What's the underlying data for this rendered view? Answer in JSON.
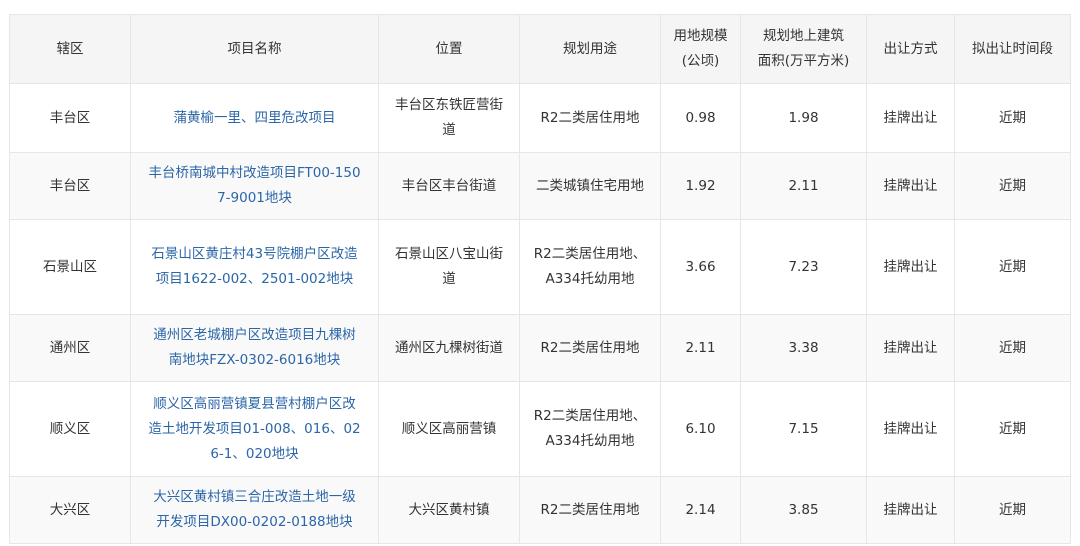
{
  "headers": [
    "辖区",
    "项目名称",
    "位置",
    "规划用途",
    "用地规模\n(公顷)",
    "规划地上建筑\n面积(万平方米)",
    "出让方式",
    "拟出让时间段"
  ],
  "rows": [
    {
      "district": "丰台区",
      "project": "蒲黄榆一里、四里危改项目",
      "location": "丰台区东铁匠营街道",
      "use": "R2二类居住用地",
      "area": "0.98",
      "building_area": "1.98",
      "method": "挂牌出让",
      "period": "近期"
    },
    {
      "district": "丰台区",
      "project": "丰台桥南城中村改造项目FT00-1507-9001地块",
      "location": "丰台区丰台街道",
      "use": "二类城镇住宅用地",
      "area": "1.92",
      "building_area": "2.11",
      "method": "挂牌出让",
      "period": "近期"
    },
    {
      "district": "石景山区",
      "project": "石景山区黄庄村43号院棚户区改造项目1622-002、2501-002地块",
      "location": "石景山区八宝山街道",
      "use": "R2二类居住用地、A334托幼用地",
      "area": "3.66",
      "building_area": "7.23",
      "method": "挂牌出让",
      "period": "近期"
    },
    {
      "district": "通州区",
      "project": "通州区老城棚户区改造项目九棵树南地块FZX-0302-6016地块",
      "location": "通州区九棵树街道",
      "use": "R2二类居住用地",
      "area": "2.11",
      "building_area": "3.38",
      "method": "挂牌出让",
      "period": "近期"
    },
    {
      "district": "顺义区",
      "project": "顺义区高丽营镇夏县营村棚户区改造土地开发项目01-008、016、026-1、020地块",
      "location": "顺义区高丽营镇",
      "use": "R2二类居住用地、A334托幼用地",
      "area": "6.10",
      "building_area": "7.15",
      "method": "挂牌出让",
      "period": "近期"
    },
    {
      "district": "大兴区",
      "project": "大兴区黄村镇三合庄改造土地一级开发项目DX00-0202-0188地块",
      "location": "大兴区黄村镇",
      "use": "R2二类居住用地",
      "area": "2.14",
      "building_area": "3.85",
      "method": "挂牌出让",
      "period": "近期"
    }
  ],
  "colors": {
    "link": "#2b66a8",
    "header_bg": "#f5f5f5",
    "border": "#e6e6e6",
    "stripe": "#f9f9f9"
  }
}
